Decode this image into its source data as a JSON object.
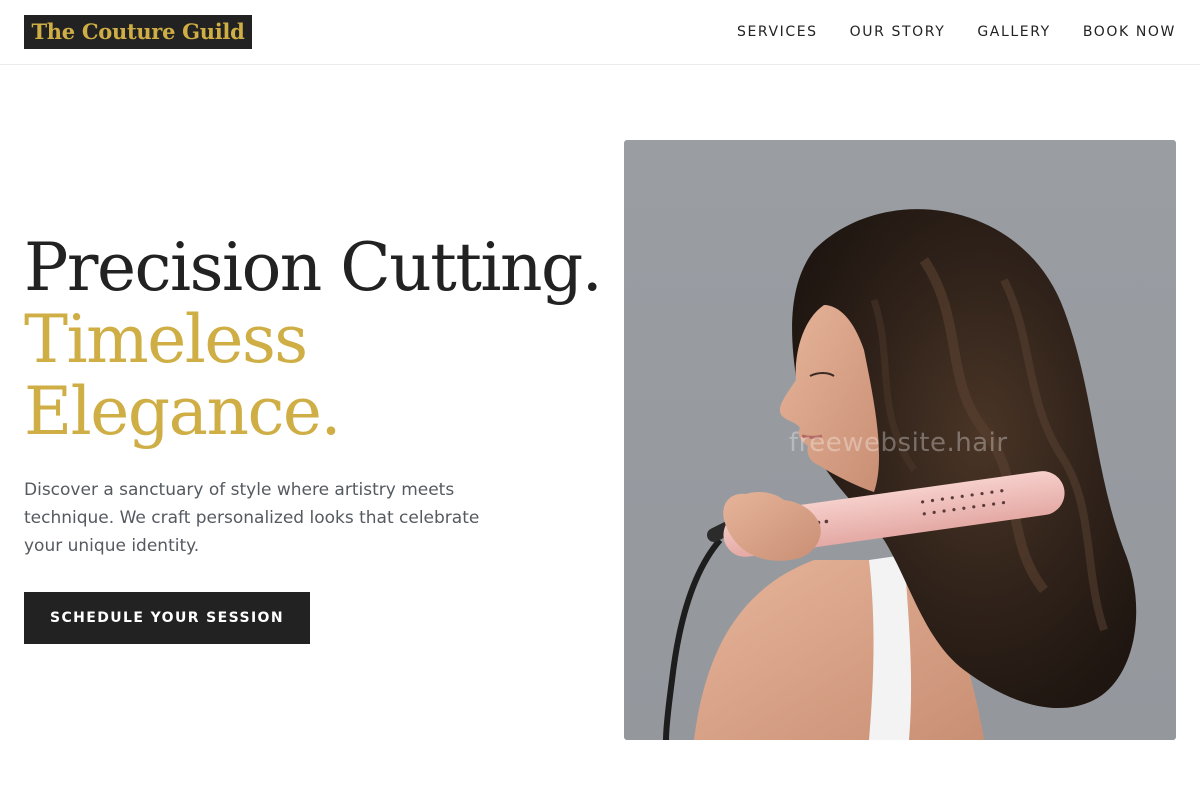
{
  "header": {
    "logo_text": "The Couture Guild",
    "nav": [
      {
        "label": "SERVICES"
      },
      {
        "label": "OUR STORY"
      },
      {
        "label": "GALLERY"
      },
      {
        "label": "BOOK NOW"
      }
    ]
  },
  "hero": {
    "title_line1": "Precision Cutting.",
    "title_accent": "Timeless Elegance.",
    "description": "Discover a sanctuary of style where artistry meets technique. We craft personalized looks that celebrate your unique identity.",
    "cta_label": "SCHEDULE YOUR SESSION",
    "image_watermark": "freewebsite.hair"
  },
  "colors": {
    "accent_gold": "#cfae45",
    "dark": "#222222",
    "body_text": "#555a61",
    "image_background": "#9a9ea3"
  }
}
